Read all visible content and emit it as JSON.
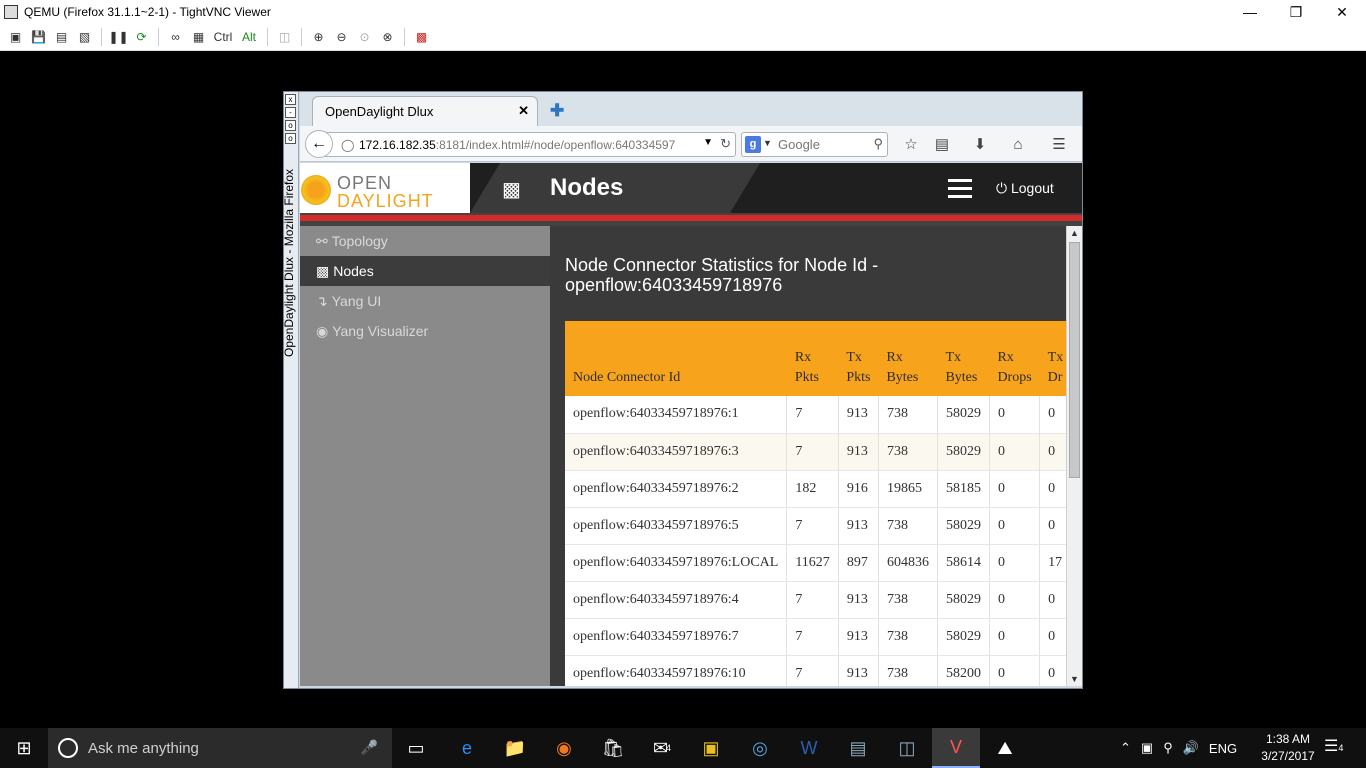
{
  "vnc": {
    "title": "QEMU (Firefox 31.1.1~2-1) - TightVNC Viewer",
    "toolbar_ctrl": "Ctrl",
    "toolbar_alt": "Alt"
  },
  "firefox": {
    "sidebar_title": "OpenDaylight Dlux - Mozilla Firefox",
    "tab_title": "OpenDaylight Dlux",
    "url_host": "172.16.182.35",
    "url_rest": ":8181/index.html#/node/openflow:640334597",
    "search_placeholder": "Google"
  },
  "odl": {
    "logo_line1": "OPEN",
    "logo_line2": "DAYLIGHT",
    "header_title": "Nodes",
    "logout_label": "Logout",
    "nav": [
      {
        "label": "Topology",
        "icon": "link-icon"
      },
      {
        "label": "Nodes",
        "icon": "hierarchy-icon",
        "active": true
      },
      {
        "label": "Yang UI",
        "icon": "arrow-down-icon"
      },
      {
        "label": "Yang Visualizer",
        "icon": "eye-icon"
      }
    ],
    "heading_line1": "Node Connector Statistics for Node Id -",
    "heading_line2": "openflow:64033459718976",
    "table": {
      "headers": [
        "Node Connector Id",
        "Rx Pkts",
        "Tx Pkts",
        "Rx Bytes",
        "Tx Bytes",
        "Rx Drops",
        "Tx Dr"
      ],
      "rows": [
        [
          "openflow:64033459718976:1",
          "7",
          "913",
          "738",
          "58029",
          "0",
          "0"
        ],
        [
          "openflow:64033459718976:3",
          "7",
          "913",
          "738",
          "58029",
          "0",
          "0"
        ],
        [
          "openflow:64033459718976:2",
          "182",
          "916",
          "19865",
          "58185",
          "0",
          "0"
        ],
        [
          "openflow:64033459718976:5",
          "7",
          "913",
          "738",
          "58029",
          "0",
          "0"
        ],
        [
          "openflow:64033459718976:LOCAL",
          "11627",
          "897",
          "604836",
          "58614",
          "0",
          "17"
        ],
        [
          "openflow:64033459718976:4",
          "7",
          "913",
          "738",
          "58029",
          "0",
          "0"
        ],
        [
          "openflow:64033459718976:7",
          "7",
          "913",
          "738",
          "58029",
          "0",
          "0"
        ],
        [
          "openflow:64033459718976:10",
          "7",
          "913",
          "738",
          "58200",
          "0",
          "0"
        ]
      ]
    }
  },
  "taskbar": {
    "search_placeholder": "Ask me anything",
    "language": "ENG",
    "time": "1:38 AM",
    "date": "3/27/2017",
    "mail_badge": "4",
    "notif_badge": "4"
  },
  "colors": {
    "accent_orange": "#f7a31b",
    "red_bar": "#d52a2a",
    "header_dark": "#1f1f1f"
  }
}
